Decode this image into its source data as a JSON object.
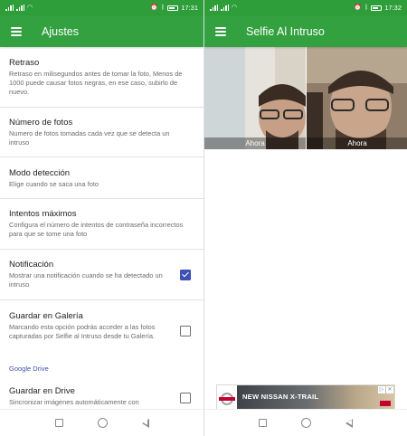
{
  "left": {
    "status": {
      "time": "17:31"
    },
    "appbar": {
      "title": "Ajustes",
      "menu_icon": "menu-icon"
    },
    "settings": [
      {
        "title": "Retraso",
        "summary": "Retraso en milisegundos antes de tomar la foto, Menos de 1000 puede causar fotos negras, en ese caso, subirlo de nuevo."
      },
      {
        "title": "Número de fotos",
        "summary": "Numero de fotos tomadas cada vez que se detecta un intruso"
      },
      {
        "title": "Modo detección",
        "summary": "Elige cuando se saca una foto"
      },
      {
        "title": "Intentos máximos",
        "summary": "Configura el número de intentos de contraseña incorrectos para que se tome una foto"
      },
      {
        "title": "Notificación",
        "summary": "Mostrar una notificación cuando se ha detectado un intruso",
        "checked": true
      },
      {
        "title": "Guardar en Galería",
        "summary": "Marcando esta opción podrás acceder a las fotos capturadas por Selfie al Intruso desde tu Galería.",
        "checked": false
      }
    ],
    "category_google_drive": "Google Drive",
    "drive_setting": {
      "title": "Guardar en Drive",
      "summary": "Sincronizar imágenes automáticamente con",
      "checked": false
    }
  },
  "right": {
    "status": {
      "time": "17:32"
    },
    "appbar": {
      "title": "Selfie Al Intruso",
      "menu_icon": "menu-icon"
    },
    "photos": [
      {
        "caption": "Ahora"
      },
      {
        "caption": "Ahora"
      }
    ],
    "ad": {
      "text": "NEW NISSAN X-TRAIL",
      "info_icon": "info-icon",
      "close_icon": "close-icon"
    }
  },
  "colors": {
    "status_bar": "#2e9e3a",
    "app_bar": "#33a13f",
    "accent": "#3f51b5"
  }
}
